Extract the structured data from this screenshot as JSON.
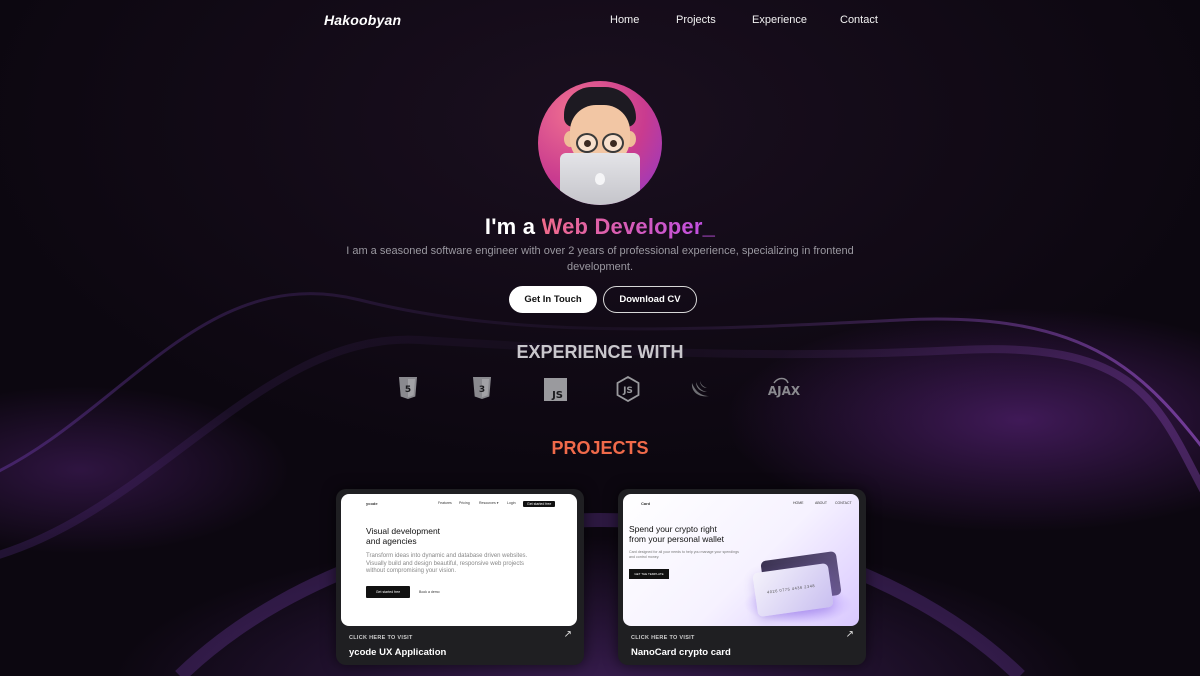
{
  "nav": {
    "logo": "Hakoobyan",
    "links": [
      "Home",
      "Projects",
      "Experience",
      "Contact"
    ]
  },
  "hero": {
    "title_prefix": "I'm a",
    "title_highlight": "Web Developer",
    "title_cursor": "_",
    "subtitle": "I am a seasoned software engineer with over 2 years of professional experience, specializing in frontend development.",
    "primary_button": "Get In Touch",
    "secondary_button": "Download CV"
  },
  "experience": {
    "title": "EXPERIENCE WITH",
    "tech_icons": [
      "html5-icon",
      "css3-icon",
      "javascript-icon",
      "nodejs-icon",
      "jquery-icon",
      "ajax-icon"
    ],
    "js_label": "JS",
    "ajax_label": "AJAX"
  },
  "projects": {
    "title": "PROJECTS",
    "items": [
      {
        "caption": "CLICK HERE TO VISIT",
        "name": "ycode UX Application",
        "preview": {
          "brand": "ycode",
          "nav": [
            "Features",
            "Pricing",
            "Resources ▾",
            "Login"
          ],
          "cta": "Get started free",
          "heading_line1": "Visual development",
          "heading_line2": "and agencies",
          "paragraph": "Transform ideas into dynamic and database driven websites. Visually build and design beautiful, responsive web projects without compromising your vision.",
          "button_primary": "Get started free",
          "button_secondary": "Book a demo"
        }
      },
      {
        "caption": "CLICK HERE TO VISIT",
        "name": "NanoCard crypto card",
        "preview": {
          "brand": "Card",
          "nav": [
            "HOME",
            "ABOUT",
            "CONTACT"
          ],
          "heading_line1": "Spend your crypto right",
          "heading_line2": "from your personal wallet",
          "paragraph": "Card designed for all your needs to help you manage your spendings and control money.",
          "button": "GET THE TEMPLATE",
          "card_number": "4026 0775 4436 2348"
        }
      }
    ]
  },
  "colors": {
    "accent_pink": "#f06a8a",
    "accent_purple": "#c04fe0",
    "projects_title": "#f06a4a",
    "background": "#0c0710"
  }
}
